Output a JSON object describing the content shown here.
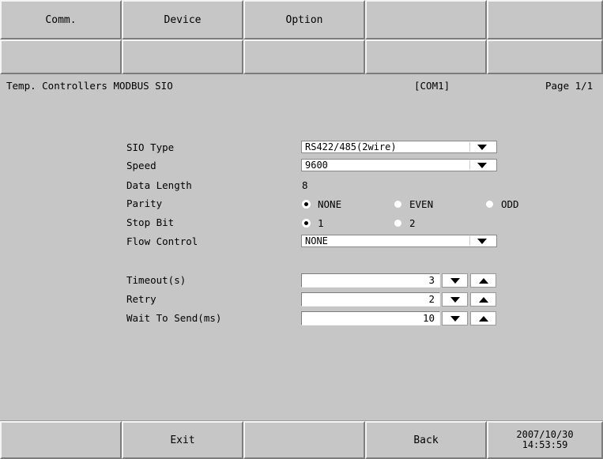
{
  "tabs": [
    "Comm.",
    "Device",
    "Option",
    "",
    ""
  ],
  "header": {
    "title": "Temp. Controllers MODBUS SIO",
    "port": "[COM1]",
    "page": "Page 1/1"
  },
  "settings": {
    "sio_type": {
      "label": "SIO Type",
      "value": "RS422/485(2wire)"
    },
    "speed": {
      "label": "Speed",
      "value": "9600"
    },
    "data_length": {
      "label": "Data Length",
      "value": "8"
    },
    "parity": {
      "label": "Parity",
      "options": [
        "NONE",
        "EVEN",
        "ODD"
      ],
      "selected": "NONE"
    },
    "stop_bit": {
      "label": "Stop Bit",
      "options": [
        "1",
        "2"
      ],
      "selected": "1"
    },
    "flow_control": {
      "label": "Flow Control",
      "value": "NONE"
    },
    "timeout": {
      "label": "Timeout(s)",
      "value": "3"
    },
    "retry": {
      "label": "Retry",
      "value": "2"
    },
    "wait_to_send": {
      "label": "Wait To Send(ms)",
      "value": "10"
    }
  },
  "footer": {
    "exit_label": "Exit",
    "back_label": "Back",
    "date": "2007/10/30",
    "time": "14:53:59"
  },
  "icons": {
    "dropdown": "triangle-down",
    "spin_down": "triangle-down",
    "spin_up": "triangle-up",
    "radio_on": "filled-dot",
    "radio_off": "white-dot"
  }
}
